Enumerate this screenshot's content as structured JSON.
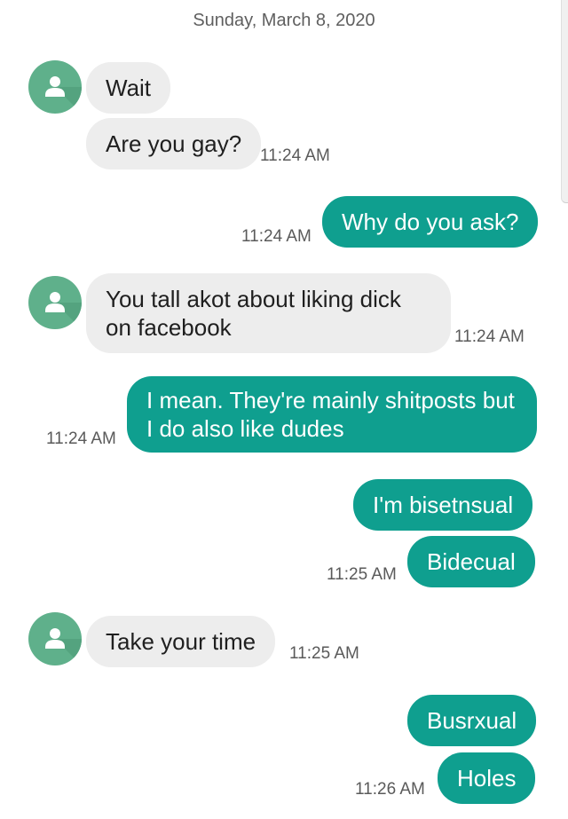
{
  "date_header": "Sunday, March 8, 2020",
  "colors": {
    "incoming": "#ededed",
    "outgoing": "#0f9f8f",
    "avatar": "#5fb08b"
  },
  "icons": {
    "avatar": "person-icon"
  },
  "messages": [
    {
      "direction": "incoming",
      "text": "Wait"
    },
    {
      "direction": "incoming",
      "text": "Are you gay?",
      "time": "11:24 AM"
    },
    {
      "direction": "outgoing",
      "text": "Why do you ask?",
      "time": "11:24 AM"
    },
    {
      "direction": "incoming",
      "text": "You tall akot about liking dick on facebook",
      "time": "11:24 AM"
    },
    {
      "direction": "outgoing",
      "text": "I mean. They're mainly shitposts but I do also like dudes",
      "time": "11:24 AM"
    },
    {
      "direction": "outgoing",
      "text": "I'm bisetnsual"
    },
    {
      "direction": "outgoing",
      "text": "Bidecual",
      "time": "11:25 AM"
    },
    {
      "direction": "incoming",
      "text": "Take your time",
      "time": "11:25 AM"
    },
    {
      "direction": "outgoing",
      "text": "Busrxual"
    },
    {
      "direction": "outgoing",
      "text": "Holes",
      "time": "11:26 AM"
    }
  ]
}
